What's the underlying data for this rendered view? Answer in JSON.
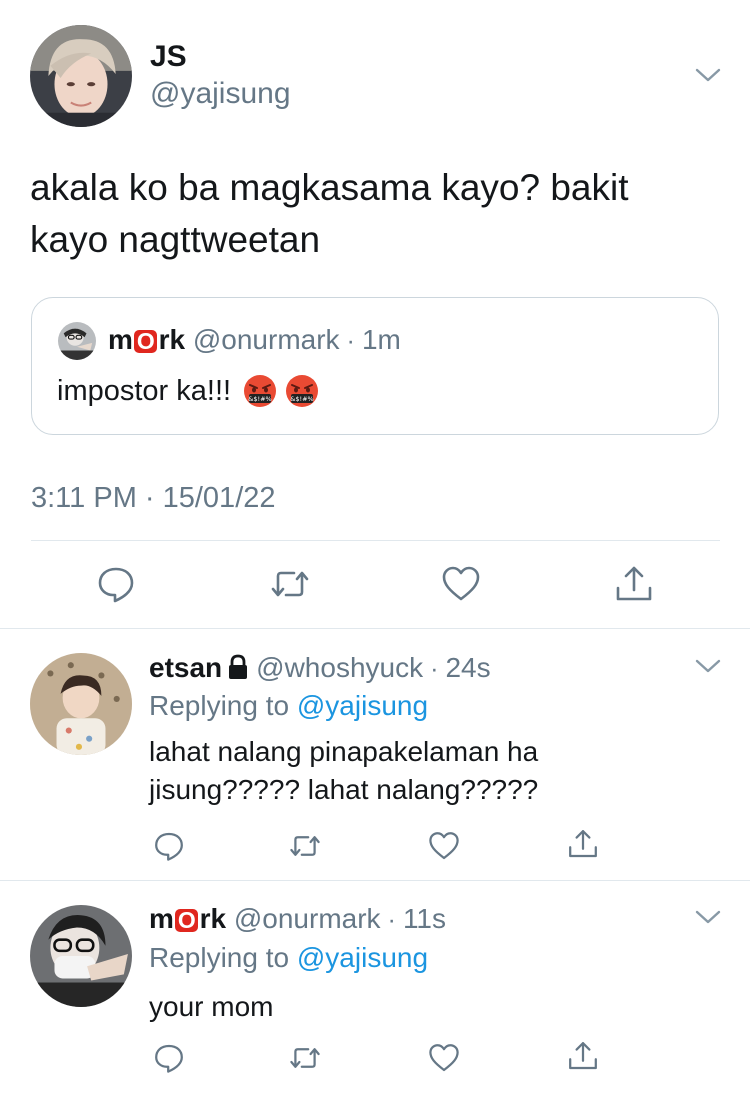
{
  "main_tweet": {
    "author": {
      "name": "JS",
      "handle": "@yajisung",
      "avatar": "avatar-photo"
    },
    "text_lines": [
      "akala ko ba magkasama kayo? bakit",
      "kayo nagttweetan"
    ],
    "quoted": {
      "name_before": "m",
      "name_badge": "O",
      "name_after": "rk",
      "handle": "@onurmark",
      "sep": "·",
      "time": "1m",
      "text": "impostor ka!!!",
      "emoji": [
        "face-with-symbols-on-mouth",
        "face-with-symbols-on-mouth"
      ]
    },
    "timestamp": "3:11 PM · 15/01/22",
    "actions": [
      "reply-icon",
      "retweet-icon",
      "like-icon",
      "share-icon"
    ]
  },
  "replies": [
    {
      "name": "etsan",
      "locked": true,
      "handle": "@whoshyuck",
      "sep": "·",
      "time": "24s",
      "replying_label": "Replying to",
      "replying_to": "@yajisung",
      "body_lines": [
        "lahat nalang pinapakelaman ha",
        "jisung????? lahat nalang?????"
      ]
    },
    {
      "name_before": "m",
      "name_badge": "O",
      "name_after": "rk",
      "handle": "@onurmark",
      "sep": "·",
      "time": "11s",
      "replying_label": "Replying to",
      "replying_to": "@yajisung",
      "body_lines": [
        "your mom"
      ]
    }
  ],
  "colors": {
    "text": "#14171a",
    "muted": "#657786",
    "link": "#1b95e0",
    "divider": "#e1e8ed",
    "badge": "#e0271f"
  }
}
